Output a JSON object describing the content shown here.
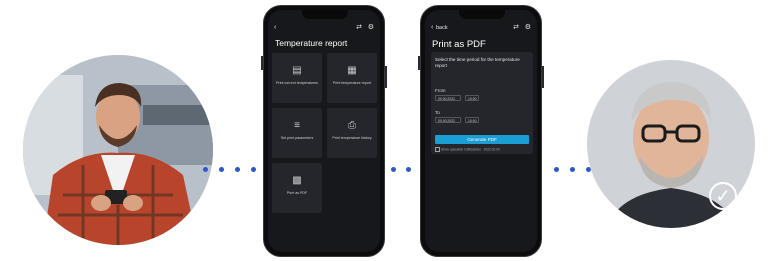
{
  "phone1": {
    "title": "Temperature report",
    "tiles": [
      {
        "label": "Print current temperatures",
        "icon": "thermometer-icon"
      },
      {
        "label": "Print temperature report",
        "icon": "report-icon"
      },
      {
        "label": "Set print parameters",
        "icon": "settings-sliders-icon"
      },
      {
        "label": "Print temperature history",
        "icon": "print-icon"
      },
      {
        "label": "Print as PDF",
        "icon": "pdf-icon"
      }
    ]
  },
  "phone2": {
    "back_label": "back",
    "title": "Print as PDF",
    "prompt": "Select the time period for the temperature report",
    "from_label": "From",
    "from_date": "00.00.2022",
    "from_time": "10:00",
    "to_label": "To",
    "to_date": "00.00.2022",
    "to_time": "10:00",
    "generate_label": "Generate PDF",
    "checkbox_label": "Show operation notifications · 2022.00.00"
  },
  "colors": {
    "accent": "#1a9ed3",
    "dots": "#2f56c8",
    "phone_bg": "#17181b",
    "tile_bg": "#24262b"
  }
}
